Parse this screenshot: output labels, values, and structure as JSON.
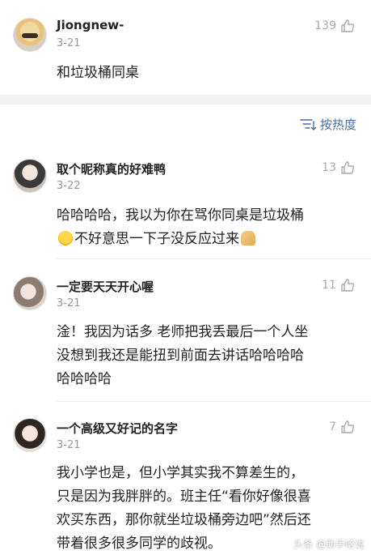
{
  "top_comment": {
    "username": "Jiongnew-",
    "date": "3-21",
    "likes": "139",
    "text": "和垃圾桶同桌"
  },
  "sort": {
    "label": "按热度",
    "icon": "sort-icon"
  },
  "replies": [
    {
      "username": "取个昵称真的好难鸭",
      "date": "3-22",
      "likes": "13",
      "line1": "哈哈哈哈，我以为你在骂你同桌是垃圾桶",
      "line2": "不好意思一下子没反应过来"
    },
    {
      "username": "一定要天天开心喔",
      "date": "3-21",
      "likes": "11",
      "line1": "淦！我因为话多 老师把我丢最后一个人坐",
      "line2": "没想到我还是能扭到前面去讲话哈哈哈哈",
      "line3": "哈哈哈哈"
    },
    {
      "username": "一个高级又好记的名字",
      "date": "3-21",
      "likes": "7",
      "line1": "我小学也是，但小学其实我不算差生的，",
      "line2": "只是因为我胖胖的。班主任“看你好像很喜",
      "line3": "欢买东西，那你就坐垃圾桶旁边吧”然后还",
      "line4": "带着很多很多同学的歧视。"
    }
  ],
  "watermark": "头条 @助手哈说",
  "colors": {
    "accent": "#4a6fa5",
    "separator": "#f2f2f2"
  }
}
